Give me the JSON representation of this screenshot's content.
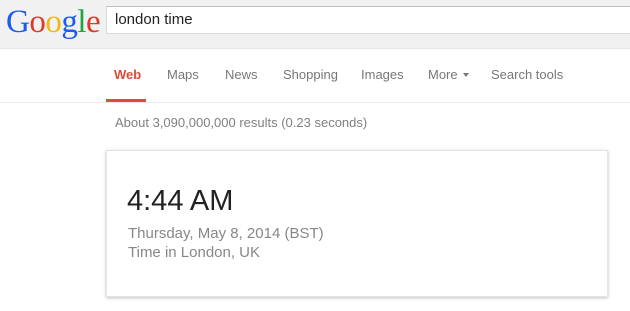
{
  "logo": {
    "letters": [
      "G",
      "o",
      "o",
      "g",
      "l",
      "e"
    ],
    "colors": [
      "#1a5ced",
      "#dd3b2a",
      "#f3b90f",
      "#1a5ced",
      "#1ea645",
      "#dd3b2a"
    ]
  },
  "search": {
    "query": "london time"
  },
  "nav": {
    "tabs": [
      {
        "label": "Web"
      },
      {
        "label": "Maps"
      },
      {
        "label": "News"
      },
      {
        "label": "Shopping"
      },
      {
        "label": "Images"
      },
      {
        "label": "More"
      },
      {
        "label": "Search tools"
      }
    ],
    "active_color": "#dd4b39"
  },
  "results": {
    "stats": "About 3,090,000,000 results (0.23 seconds)"
  },
  "time_card": {
    "time": "4:44 AM",
    "date": "Thursday, May 8, 2014 (BST)",
    "location": "Time in London, UK"
  }
}
